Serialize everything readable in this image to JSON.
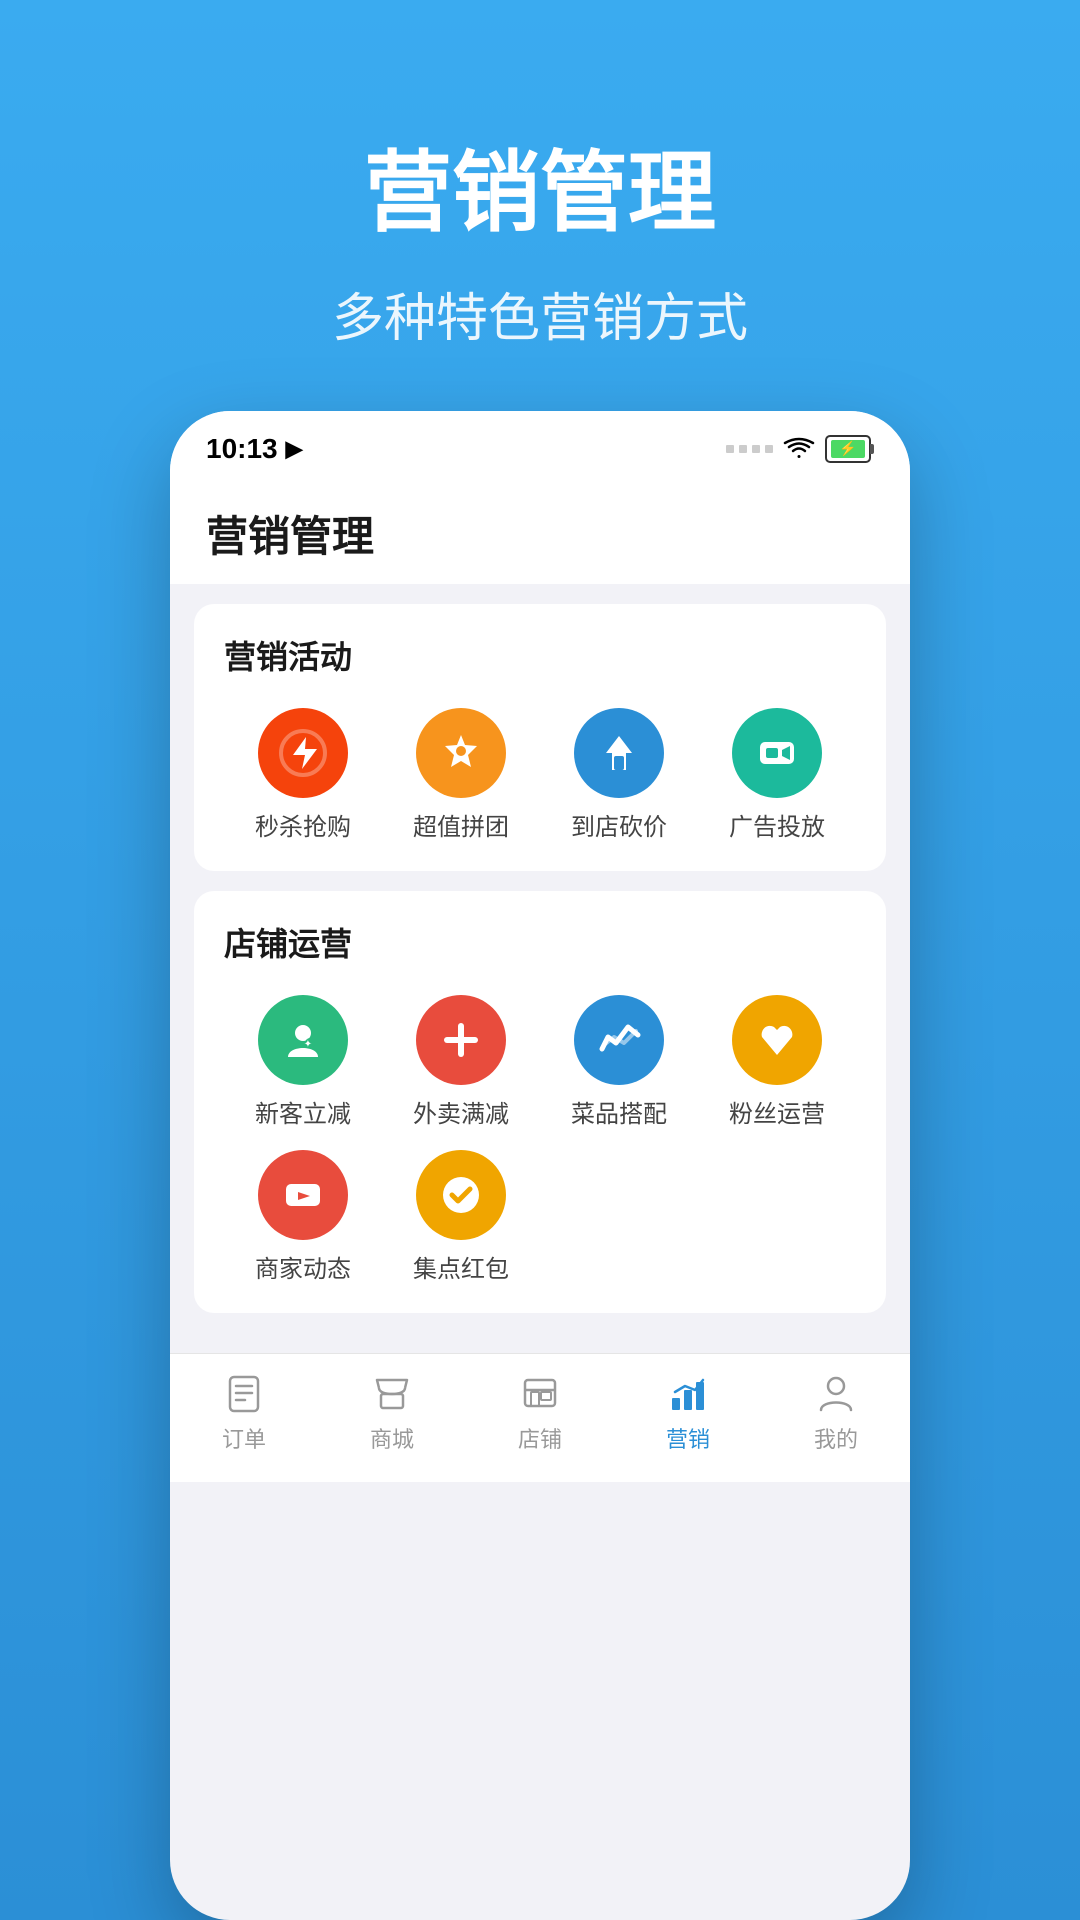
{
  "background_color": "#3aabf0",
  "header": {
    "title": "营销管理",
    "subtitle": "多种特色营销方式"
  },
  "status_bar": {
    "time": "10:13",
    "signal": "···· ",
    "wifi": "wifi",
    "battery": "charging"
  },
  "app": {
    "title": "营销管理",
    "sections": [
      {
        "id": "marketing-activities",
        "title": "营销活动",
        "items": [
          {
            "id": "flash-sale",
            "label": "秒杀抢购",
            "icon": "flash",
            "color": "ic-red"
          },
          {
            "id": "group-buy",
            "label": "超值拼团",
            "icon": "group",
            "color": "ic-orange"
          },
          {
            "id": "in-store-discount",
            "label": "到店砍价",
            "icon": "scissors",
            "color": "ic-blue"
          },
          {
            "id": "advertising",
            "label": "广告投放",
            "icon": "ad",
            "color": "ic-teal"
          }
        ]
      },
      {
        "id": "store-operations",
        "title": "店铺运营",
        "items": [
          {
            "id": "new-customer",
            "label": "新客立减",
            "icon": "person",
            "color": "ic-green"
          },
          {
            "id": "delivery-discount",
            "label": "外卖满减",
            "icon": "food",
            "color": "ic-redbtn"
          },
          {
            "id": "menu-match",
            "label": "菜品搭配",
            "icon": "thumbup",
            "color": "ic-blue"
          },
          {
            "id": "fan-ops",
            "label": "粉丝运营",
            "icon": "heart",
            "color": "ic-gold"
          },
          {
            "id": "merchant-news",
            "label": "商家动态",
            "icon": "video",
            "color": "ic-redbtn"
          },
          {
            "id": "stamp-red",
            "label": "集点红包",
            "icon": "check",
            "color": "ic-gold"
          }
        ]
      }
    ],
    "nav": [
      {
        "id": "orders",
        "label": "订单",
        "icon": "orders",
        "active": false
      },
      {
        "id": "shop",
        "label": "商城",
        "icon": "shop",
        "active": false
      },
      {
        "id": "store",
        "label": "店铺",
        "icon": "store",
        "active": false
      },
      {
        "id": "marketing",
        "label": "营销",
        "icon": "marketing",
        "active": true
      },
      {
        "id": "mine",
        "label": "我的",
        "icon": "mine",
        "active": false
      }
    ]
  }
}
